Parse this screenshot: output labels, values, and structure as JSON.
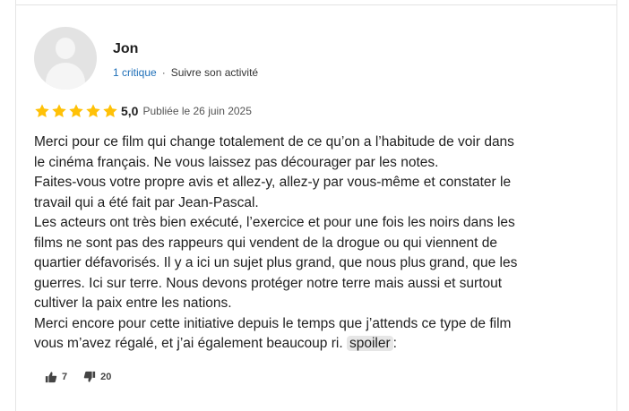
{
  "review": {
    "user_name": "Jon",
    "critique_count": "1 critique",
    "separator": "·",
    "follow_label": "Suivre son activité",
    "rating": 5,
    "rating_display": "5,0",
    "published": "Publiée le 26 juin 2025",
    "star_color": "#FFC107",
    "text_lines": [
      "Merci pour ce film qui change totalement de ce qu’on a l’habitude de voir dans",
      "le cinéma français. Ne vous laissez pas décourager par les notes.",
      "Faites-vous votre propre avis et allez-y, allez-y par vous-même et constater le",
      "travail qui a été fait par Jean-Pascal.",
      "Les acteurs ont très bien exécuté, l’exercice et pour une fois les noirs dans les",
      "films ne sont pas des rappeurs qui vendent de la drogue ou qui viennent de",
      "quartier défavorisés. Il y a ici un sujet plus grand, que nous plus grand, que les",
      "guerres. Ici sur terre. Nous devons protéger notre terre mais aussi et surtout",
      "cultiver la paix entre les nations.",
      "Merci encore pour cette initiative depuis le temps que j’attends ce type de film"
    ],
    "last_line": "vous m’avez régalé, et j’ai également beaucoup ri.",
    "spoiler_label": "spoiler",
    "spoiler_suffix": ":",
    "likes": "7",
    "dislikes": "20",
    "icons": {
      "avatar": "user-avatar-placeholder",
      "star": "star-icon",
      "like": "thumbs-up-icon",
      "dislike": "thumbs-down-icon"
    }
  }
}
